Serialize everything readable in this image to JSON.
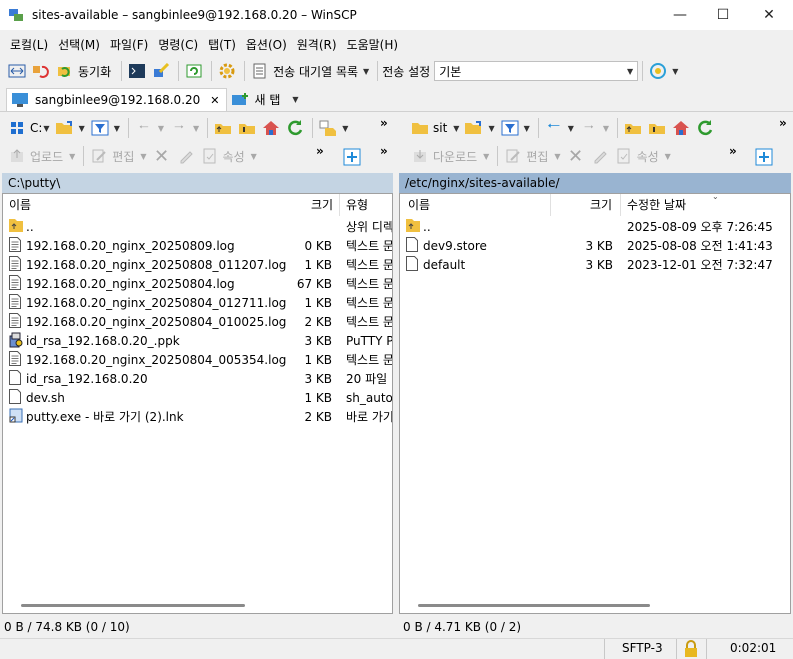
{
  "window": {
    "title": "sites-available – sangbinlee9@192.168.0.20 – WinSCP"
  },
  "menu": [
    "로컬(L)",
    "선택(M)",
    "파일(F)",
    "명령(C)",
    "탭(T)",
    "옵션(O)",
    "원격(R)",
    "도움말(H)"
  ],
  "toolbar": {
    "sync_label": "동기화",
    "queue_label": "전송 대기열 목록",
    "transfer_settings_label": "전송 설정",
    "transfer_preset_value": "기본"
  },
  "tabs": [
    {
      "label": "sangbinlee9@192.168.0.20"
    },
    {
      "label": "새 탭"
    }
  ],
  "local_toolbar": {
    "drive": "C:",
    "upload_label": "업로드",
    "edit_label": "편집",
    "props_label": "속성"
  },
  "remote_toolbar": {
    "dir": "sit",
    "download_label": "다운로드",
    "edit_label": "편집",
    "props_label": "속성"
  },
  "local": {
    "path": "C:\\putty\\",
    "columns": {
      "name": "이름",
      "size": "크기",
      "type": "유형"
    },
    "files": [
      {
        "name": "..",
        "size": "",
        "type": "상위 디렉",
        "icon": "folder-up"
      },
      {
        "name": "192.168.0.20_nginx_20250809.log",
        "size": "0 KB",
        "type": "텍스트 문",
        "icon": "text-file"
      },
      {
        "name": "192.168.0.20_nginx_20250808_011207.log",
        "size": "1 KB",
        "type": "텍스트 문",
        "icon": "text-file"
      },
      {
        "name": "192.168.0.20_nginx_20250804.log",
        "size": "67 KB",
        "type": "텍스트 문",
        "icon": "text-file"
      },
      {
        "name": "192.168.0.20_nginx_20250804_012711.log",
        "size": "1 KB",
        "type": "텍스트 문",
        "icon": "text-file"
      },
      {
        "name": "192.168.0.20_nginx_20250804_010025.log",
        "size": "2 KB",
        "type": "텍스트 문",
        "icon": "text-file"
      },
      {
        "name": "id_rsa_192.168.0.20_.ppk",
        "size": "3 KB",
        "type": "PuTTY Pr",
        "icon": "ppk-file"
      },
      {
        "name": "192.168.0.20_nginx_20250804_005354.log",
        "size": "1 KB",
        "type": "텍스트 문",
        "icon": "text-file"
      },
      {
        "name": "id_rsa_192.168.0.20",
        "size": "3 KB",
        "type": "20 파일",
        "icon": "blank-file"
      },
      {
        "name": "dev.sh",
        "size": "1 KB",
        "type": "sh_auto_",
        "icon": "blank-file"
      },
      {
        "name": "putty.exe - 바로 가기 (2).lnk",
        "size": "2 KB",
        "type": "바로 가기",
        "icon": "shortcut-file"
      }
    ],
    "status": "0 B / 74.8 KB (0 / 10)"
  },
  "remote": {
    "path": "/etc/nginx/sites-available/",
    "columns": {
      "name": "이름",
      "size": "크기",
      "modified": "수정한 날짜"
    },
    "files": [
      {
        "name": "..",
        "size": "",
        "modified": "2025-08-09 오후 7:26:45",
        "icon": "folder-up"
      },
      {
        "name": "dev9.store",
        "size": "3 KB",
        "modified": "2025-08-08 오전 1:41:43",
        "icon": "blank-file"
      },
      {
        "name": "default",
        "size": "3 KB",
        "modified": "2023-12-01 오전 7:32:47",
        "icon": "blank-file"
      }
    ],
    "status": "0 B / 4.71 KB (0 / 2)"
  },
  "statusbar": {
    "protocol": "SFTP-3",
    "elapsed": "0:02:01"
  }
}
